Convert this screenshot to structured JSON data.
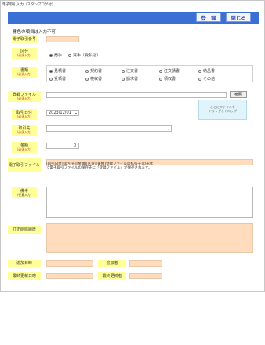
{
  "window": {
    "title": "電子取引入力（スタンプログ付）"
  },
  "toolbar": {
    "register_label": "登　録",
    "close_label": "閉じる"
  },
  "note": "標色の項目は入力不可",
  "fields": {
    "entry_no": {
      "label": "電子取引番号",
      "value": ""
    },
    "category": {
      "label": "区分",
      "required": "（必須入力）",
      "options": [
        "売手",
        "買手（受払込）"
      ],
      "selected": 0
    },
    "doc_type": {
      "label": "書類",
      "required": "（必須入力）",
      "options": [
        "見積書",
        "契約書",
        "注文書",
        "注文請書",
        "納品書",
        "受領書",
        "検収書",
        "請求書",
        "領収書",
        "その他"
      ],
      "selected": 0
    },
    "register_file": {
      "label": "登録ファイル",
      "required": "（必須入力）",
      "value": "",
      "browse_label": "参照",
      "drop_text": [
        "ここにファイルを",
        "ドラッグ＆ドロップ"
      ]
    },
    "trade_date": {
      "label": "取引日付",
      "required": "（必須入力）",
      "value": "2023/12/01"
    },
    "counterparty": {
      "label": "取引先",
      "required": "（必須入力）",
      "value": ""
    },
    "amount": {
      "label": "金額",
      "required": "（必須入力）",
      "value": "0"
    },
    "e_file": {
      "label": "電子取引ファイル",
      "value": ""
    },
    "file_info": [
      "[取引日付][取引先][金額][区分][書類]登録ファイルの拡張子]の形式",
      "で電子取引ファイルの保存先に「登録ファイル」が保存されます。"
    ],
    "remarks": {
      "label": "備考",
      "sub": "（任意入力）",
      "value": ""
    },
    "history": {
      "label": "訂正削除履歴",
      "value": ""
    },
    "added_date": {
      "label": "追加日時",
      "value": ""
    },
    "added_by": {
      "label": "追加者",
      "value": ""
    },
    "updated_date": {
      "label": "最終更新日時",
      "value": ""
    },
    "updated_by": {
      "label": "最終更新者",
      "value": ""
    }
  }
}
